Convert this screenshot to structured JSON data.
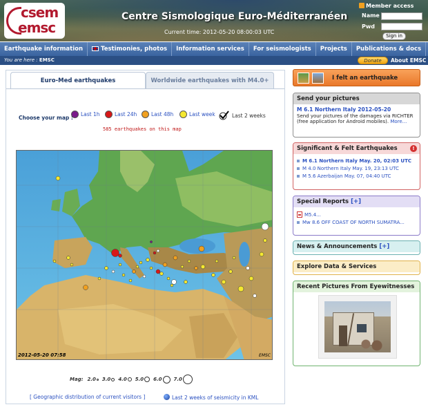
{
  "header": {
    "logo_top": "csem",
    "logo_bottom": "emsc",
    "site_title": "Centre Sismologique Euro-Méditerranéen",
    "current_time": "Current time: 2012-05-20 08:00:03 UTC",
    "member_access": "Member access",
    "name_label": "Name",
    "pwd_label": "Pwd",
    "sign_in": "Sign in"
  },
  "nav": {
    "items": [
      "Earthquake information",
      "Testimonies, photos",
      "Information services",
      "For seismologists",
      "Projects",
      "Publications & docs"
    ]
  },
  "subbar": {
    "you_are_here": "You are here :",
    "crumb": "EMSC",
    "donate": "Donate",
    "about": "About EMSC"
  },
  "tabs": {
    "euro_med": "Euro-Med earthquakes",
    "worldwide": "Worldwide earthquakes with M4.0+"
  },
  "map_legend": {
    "choose_label": "Choose your map :",
    "items": [
      {
        "label": "Last 1h",
        "color": "#7a1a8a"
      },
      {
        "label": "Last 24h",
        "color": "#d81818"
      },
      {
        "label": "Last 48h",
        "color": "#f0a020"
      },
      {
        "label": "Last week",
        "color": "#f5e830"
      },
      {
        "label": "Last 2 weeks",
        "color": "#ffffff"
      }
    ],
    "count_text": "585 earthquakes on this map"
  },
  "map": {
    "date_stamp": "2012-05-20 07:58",
    "credit": "EMSC"
  },
  "magnitudes": {
    "title": "Mag:",
    "items": [
      "2.0",
      "3.0",
      "4.0",
      "5.0",
      "6.0",
      "7.0"
    ]
  },
  "footer_links": {
    "visitors": "[ Geographic distribution of current visitors ]",
    "kml": "Last 2 weeks of seismicity in KML"
  },
  "felt": {
    "label": "I felt an earthquake"
  },
  "pictures_box": {
    "title": "Send your pictures",
    "headline": "M 6.1 Northern Italy 2012-05-20",
    "body": "Send your pictures of the damages via RICHTER (free application for Android mobiles).",
    "more": "More..."
  },
  "significant_box": {
    "title": "Significant & Felt Earthquakes",
    "items": [
      "M 6.1 Northern Italy May. 20, 02:03 UTC",
      "M 4.0 Northern Italy May. 19, 23:13 UTC",
      "M 5.6 Azerbaijan May. 07, 04:40 UTC"
    ]
  },
  "special_box": {
    "title": "Special Reports",
    "plus": "[+]",
    "items": [
      "M5.4...",
      "Mw 8.6 OFF COAST OF NORTH SUMATRA..."
    ]
  },
  "news_box": {
    "title": "News & Announcements",
    "plus": "[+]"
  },
  "explore_box": {
    "title": "Explore Data & Services"
  },
  "recent_box": {
    "title": "Recent Pictures From Eyewitnesses"
  },
  "colors": {
    "nav_blue": "#3a64a0",
    "link_blue": "#2a50c0",
    "brand_red": "#b2192e",
    "count_red": "#c01818",
    "felt_orange": "#e9782a"
  }
}
